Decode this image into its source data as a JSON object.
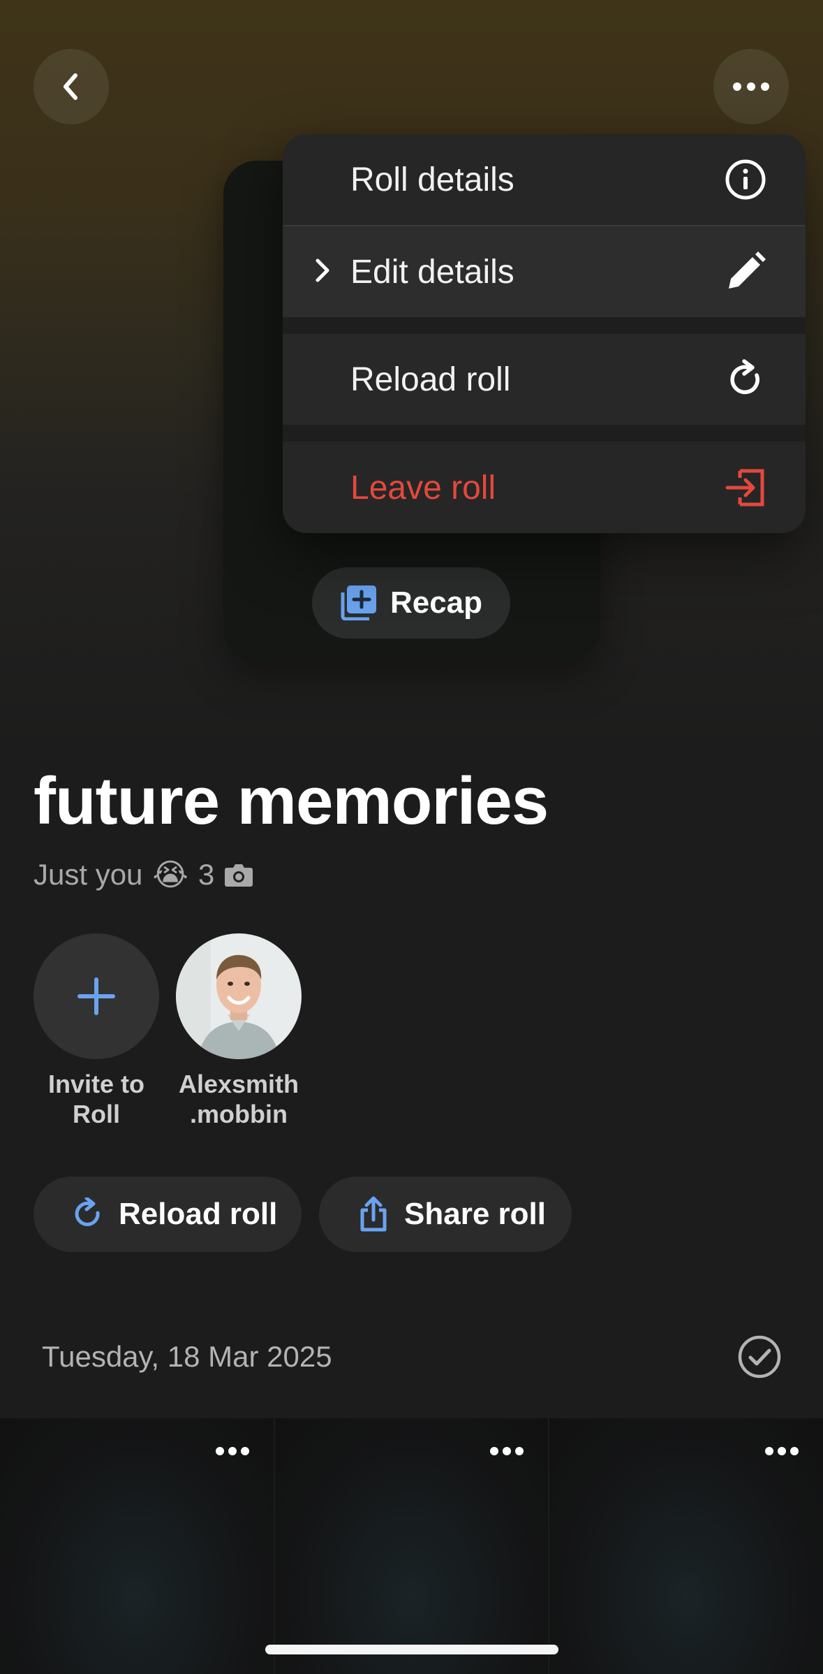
{
  "nav": {
    "back_icon": "chevron-left-icon",
    "more_icon": "ellipsis-icon"
  },
  "menu": {
    "items": [
      {
        "label": "Roll details",
        "icon": "info-icon"
      },
      {
        "label": "Edit details",
        "icon": "pencil-icon"
      },
      {
        "label": "Reload roll",
        "icon": "reload-icon"
      },
      {
        "label": "Leave roll",
        "icon": "exit-icon"
      }
    ],
    "danger_color": "#e5483d"
  },
  "recap": {
    "label": "Recap",
    "icon": "add-photos-icon"
  },
  "roll": {
    "title": "future memories",
    "subtitle_text": "Just you",
    "emoji": "😭",
    "photo_count": "3"
  },
  "members": [
    {
      "name": "Invite to\nRoll"
    },
    {
      "name": "Alexsmith\n.mobbin"
    }
  ],
  "actions": {
    "reload_label": "Reload roll",
    "share_label": "Share roll"
  },
  "section": {
    "date": "Tuesday, 18 Mar 2025"
  },
  "colors": {
    "accent": "#6aa3f0",
    "danger": "#e5483d"
  }
}
